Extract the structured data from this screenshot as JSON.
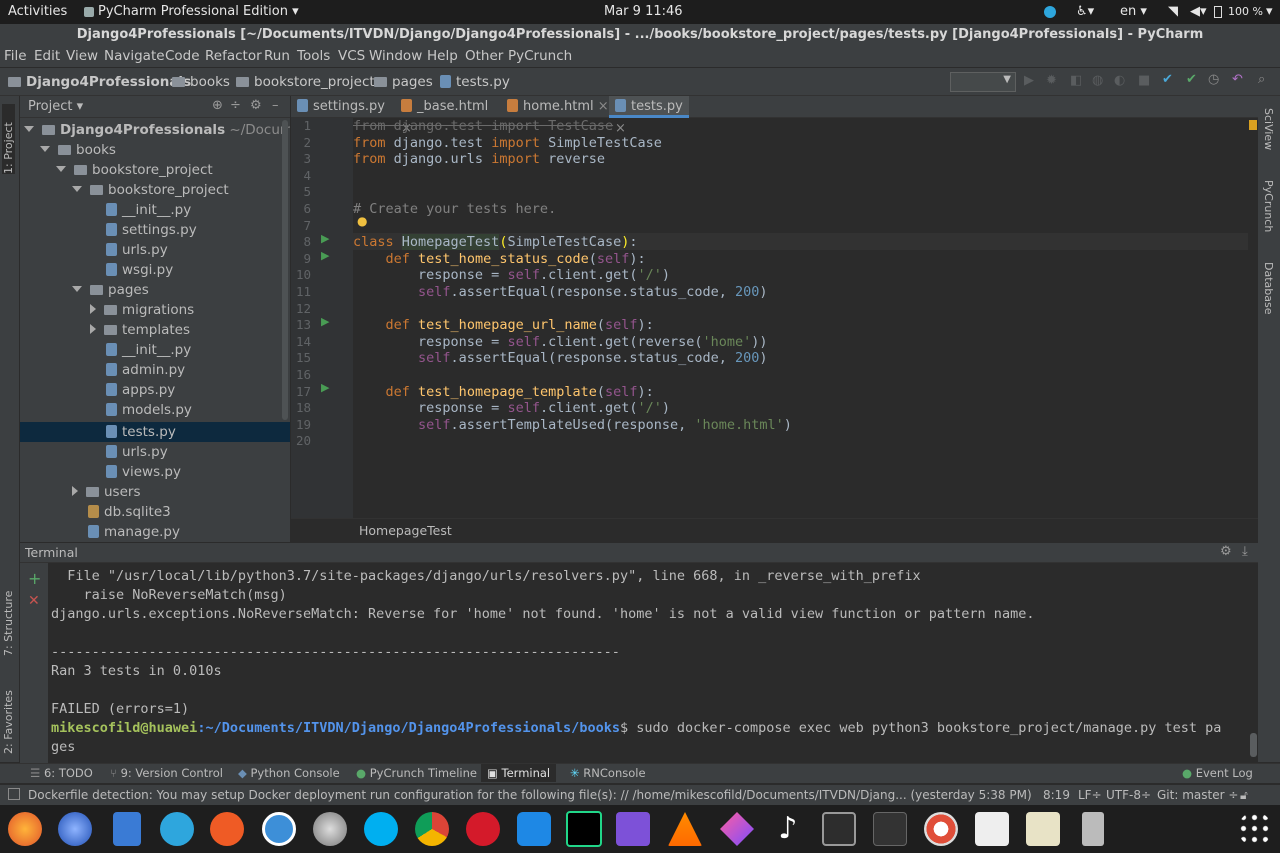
{
  "topbar": {
    "activities": "Activities",
    "app": "PyCharm Professional Edition ▾",
    "clock": "Mar 9  11:46",
    "lang": "en ▾",
    "battery": "100 %"
  },
  "window": {
    "title": "Django4Professionals [~/Documents/ITVDN/Django/Django4Professionals] - .../books/bookstore_project/pages/tests.py [Django4Professionals] - PyCharm"
  },
  "menu": [
    "File",
    "Edit",
    "View",
    "Navigate",
    "Code",
    "Refactor",
    "Run",
    "Tools",
    "VCS",
    "Window",
    "Help",
    "Other",
    "PyCrunch"
  ],
  "breadcrumbs": [
    "Django4Professionals",
    "books",
    "bookstore_project",
    "pages",
    "tests.py"
  ],
  "project": {
    "header": "Project ▾",
    "root": "Django4Professionals",
    "root_path": "~/Documents/IT",
    "items": [
      "books",
      "bookstore_project",
      "bookstore_project",
      "__init__.py",
      "settings.py",
      "urls.py",
      "wsgi.py",
      "pages",
      "migrations",
      "templates",
      "__init__.py",
      "admin.py",
      "apps.py",
      "models.py",
      "tests.py",
      "urls.py",
      "views.py",
      "users",
      "db.sqlite3",
      "manage.py"
    ]
  },
  "tabs": [
    "settings.py",
    "_base.html",
    "home.html",
    "tests.py"
  ],
  "code": {
    "linenos": [
      "1",
      "2",
      "3",
      "4",
      "5",
      "6",
      "7",
      "8",
      "9",
      "10",
      "11",
      "12",
      "13",
      "14",
      "15",
      "16",
      "17",
      "18",
      "19",
      "20"
    ],
    "breadcrumb": "HomepageTest"
  },
  "terminal": {
    "title": "Terminal",
    "lines": [
      "  File \"/usr/local/lib/python3.7/site-packages/django/urls/resolvers.py\", line 668, in _reverse_with_prefix",
      "    raise NoReverseMatch(msg)",
      "django.urls.exceptions.NoReverseMatch: Reverse for 'home' not found. 'home' is not a valid view function or pattern name.",
      "",
      "----------------------------------------------------------------------",
      "Ran 3 tests in 0.010s",
      "",
      "FAILED (errors=1)"
    ],
    "prompt_user": "mikescofild@huawei",
    "prompt_path": ":~/Documents/ITVDN/Django/Django4Professionals/books",
    "prompt_cmd": "$ sudo docker-compose exec web python3 bookstore_project/manage.py test pa",
    "prompt_wrap": "ges"
  },
  "toolwindows": [
    "6: TODO",
    "9: Version Control",
    "Python Console",
    "PyCrunch Timeline",
    "Terminal",
    "RNConsole",
    "Event Log"
  ],
  "sidetabs": {
    "left": [
      "1: Project",
      "7: Structure",
      "2: Favorites"
    ],
    "right": [
      "SciView",
      "PyCrunch",
      "Database"
    ]
  },
  "status": {
    "message": "Dockerfile detection: You may setup Docker deployment run configuration for the following file(s): // /home/mikescofild/Documents/ITVDN/Djang... (yesterday 5:38 PM)",
    "pos": "8:19",
    "lf": "LF÷",
    "enc": "UTF-8÷",
    "git": "Git: master ÷"
  },
  "dock": [
    "firefox",
    "thunderbird",
    "libreoffice",
    "telegram",
    "postman",
    "simplenote",
    "settings",
    "skype",
    "chrome",
    "opera",
    "vscode",
    "pycharm",
    "phpstorm",
    "vlc",
    "kite",
    "music",
    "monitor",
    "terminal",
    "help",
    "search",
    "notes",
    "usb",
    "app-grid"
  ],
  "colors": {
    "selection": "#0d293e",
    "keyword": "#cc7832",
    "string": "#6a8759",
    "comment": "#808080",
    "function": "#ffc66d"
  }
}
